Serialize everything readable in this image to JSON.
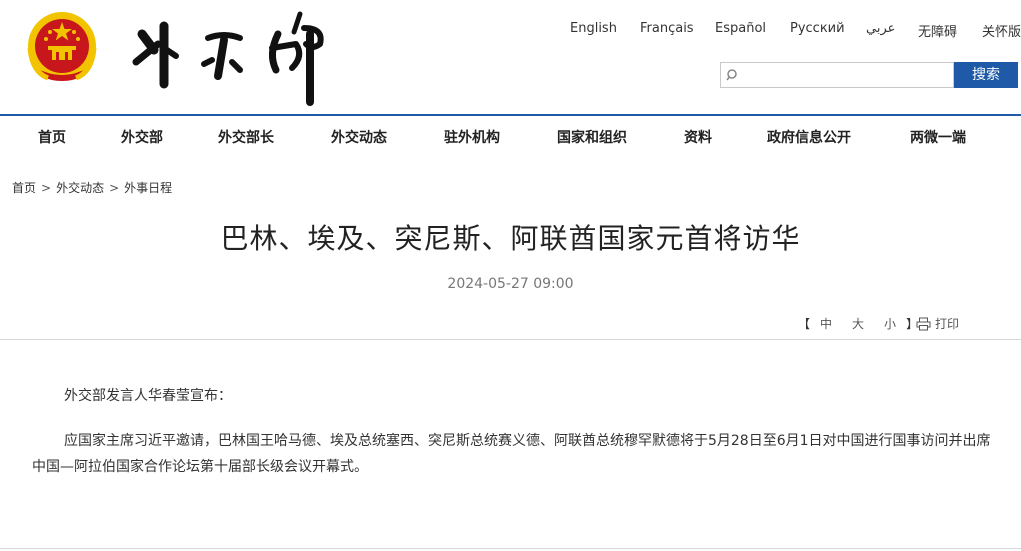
{
  "header": {
    "languages": [
      "English",
      "Français",
      "Español",
      "Русский",
      "عربي",
      "无障碍",
      "关怀版"
    ],
    "search": {
      "placeholder": "",
      "button_label": "搜索"
    }
  },
  "nav": {
    "items": [
      "首页",
      "外交部",
      "外交部长",
      "外交动态",
      "驻外机构",
      "国家和组织",
      "资料",
      "政府信息公开",
      "两微一端"
    ]
  },
  "breadcrumb": [
    "首页",
    "外交动态",
    "外事日程"
  ],
  "article": {
    "title": "巴林、埃及、突尼斯、阿联酋国家元首将访华",
    "date": "2024-05-27 09:00",
    "font_size": {
      "open": "【",
      "large": "中",
      "medium": "大",
      "small": "小",
      "close": "】"
    },
    "print_label": "打印",
    "paragraphs": [
      "外交部发言人华春莹宣布：",
      "应国家主席习近平邀请，巴林国王哈马德、埃及总统塞西、突尼斯总统赛义德、阿联酋总统穆罕默德将于5月28日至6月1日对中国进行国事访问并出席中国—阿拉伯国家合作论坛第十届部长级会议开幕式。"
    ]
  },
  "colors": {
    "accent_blue": "#1e5aa8",
    "emblem_red": "#c8161d",
    "emblem_gold": "#f2c400"
  },
  "icons": [
    "national-emblem",
    "search-icon",
    "printer-icon"
  ]
}
